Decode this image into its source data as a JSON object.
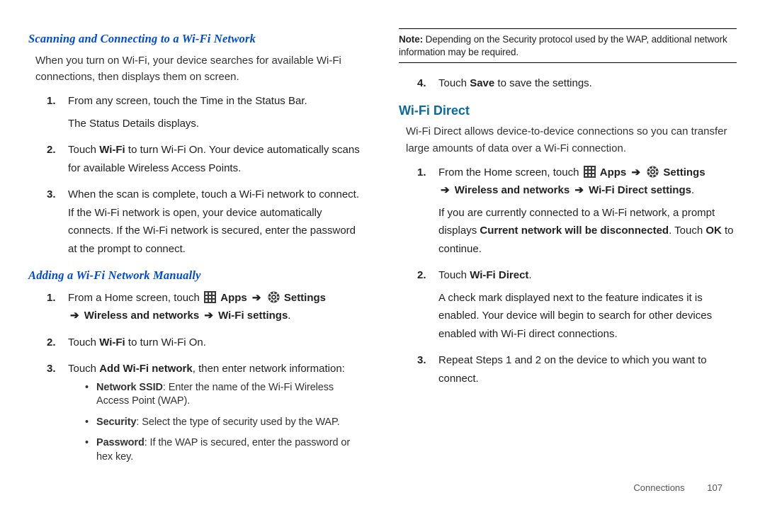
{
  "left": {
    "h1": "Scanning and Connecting to a Wi-Fi Network",
    "intro": "When you turn on Wi-Fi, your device searches for available Wi-Fi connections, then displays them on screen.",
    "s1a": "From any screen, touch the Time in the Status Bar.",
    "s1b": "The Status Details displays.",
    "s2a": "Touch ",
    "s2b": "Wi-Fi",
    "s2c": " to turn Wi-Fi On. Your device automatically scans for available Wireless Access Points.",
    "s3": "When the scan is complete, touch a Wi-Fi network to connect. If the Wi-Fi network is open, your device automatically connects. If the Wi-Fi network is secured, enter the password at the prompt to connect.",
    "h2": "Adding a Wi-Fi Network Manually",
    "m1a": "From a Home screen, touch ",
    "apps": "Apps",
    "arrow": "➔",
    "settings": "Settings",
    "m1b": "Wireless and networks",
    "m1c": "Wi-Fi settings",
    "m2a": "Touch ",
    "m2b": "Wi-Fi",
    "m2c": " to turn Wi-Fi On.",
    "m3a": "Touch ",
    "m3b": "Add Wi-Fi network",
    "m3c": ", then enter network information:",
    "b1a": "Network SSID",
    "b1b": ": Enter the name of the Wi-Fi Wireless Access Point (WAP).",
    "b2a": "Security",
    "b2b": ": Select the type of security used by the WAP.",
    "b3a": "Password",
    "b3b": ": If the WAP is secured, enter the password or hex key."
  },
  "right": {
    "noteLabel": "Note:",
    "noteText": " Depending on the Security protocol used by the WAP, additional network information may be required.",
    "r4a": "Touch ",
    "r4b": "Save",
    "r4c": " to save the settings.",
    "h3": "Wi-Fi Direct",
    "intro": "Wi-Fi Direct allows device-to-device connections so you can transfer large amounts of data over a Wi-Fi connection.",
    "d1a": "From the Home screen, touch ",
    "d1path2": "Wireless and networks",
    "d1path3": "Wi-Fi Direct settings",
    "d1x": "If you are currently connected to a Wi-Fi network, a prompt displays ",
    "d1y": "Current network will be disconnected",
    "d1z1": ". Touch ",
    "d1z2": "OK",
    "d1z3": " to continue.",
    "d2a": "Touch ",
    "d2b": "Wi-Fi Direct",
    "d2c": ".",
    "d2d": "A check mark displayed next to the feature indicates it is enabled. Your device will begin to search for other devices enabled with Wi-Fi direct connections.",
    "d3": "Repeat Steps 1 and 2 on the device to which you want to connect."
  },
  "footer": {
    "chapter": "Connections",
    "page": "107"
  }
}
